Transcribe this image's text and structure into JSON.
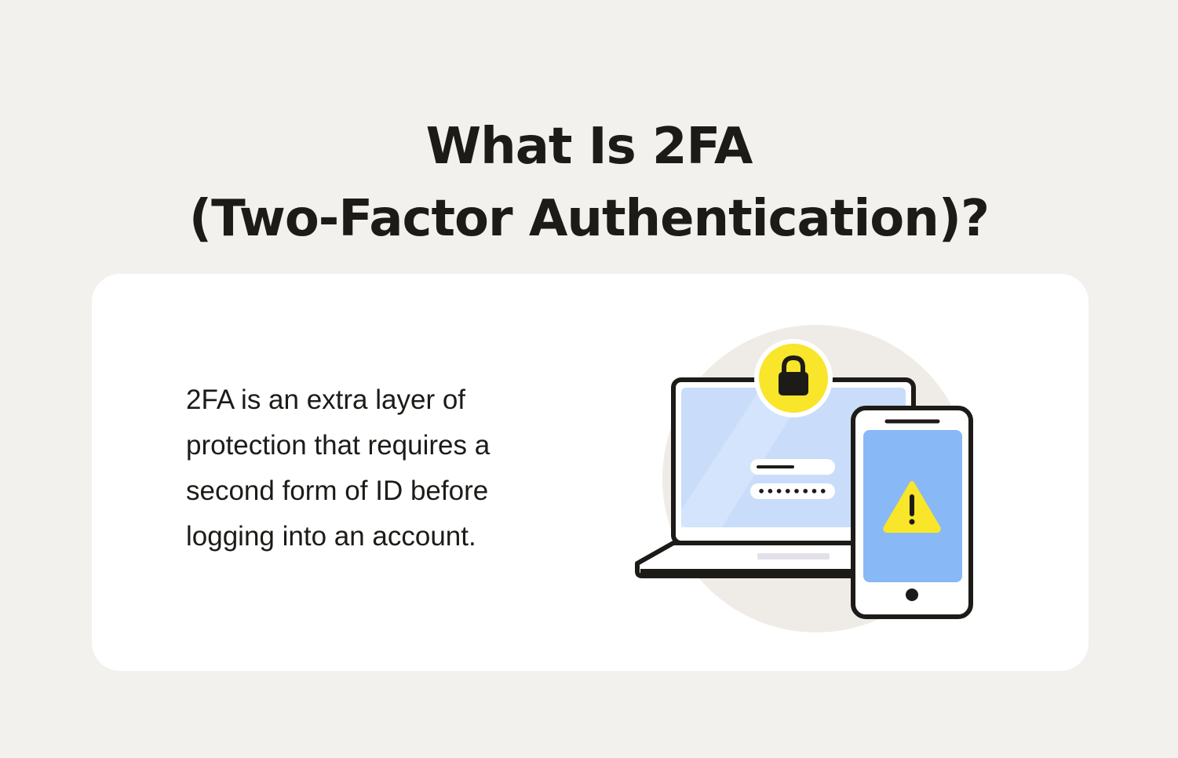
{
  "title": {
    "line1": "What Is 2FA",
    "line2": "(Two-Factor Authentication)?"
  },
  "description": "2FA is an extra layer of protection that requires a second form of ID before logging into an account.",
  "illustration": {
    "icons": [
      "laptop-icon",
      "lock-icon",
      "smartphone-icon",
      "warning-icon"
    ],
    "password_mask": "••••••••"
  },
  "colors": {
    "background": "#f3f1ed",
    "card": "#ffffff",
    "accent_yellow": "#f9e52a",
    "laptop_screen": "#c9ddfa",
    "phone_screen": "#88b8f5",
    "outline": "#1d1b18",
    "backdrop_circle": "#efece7"
  }
}
